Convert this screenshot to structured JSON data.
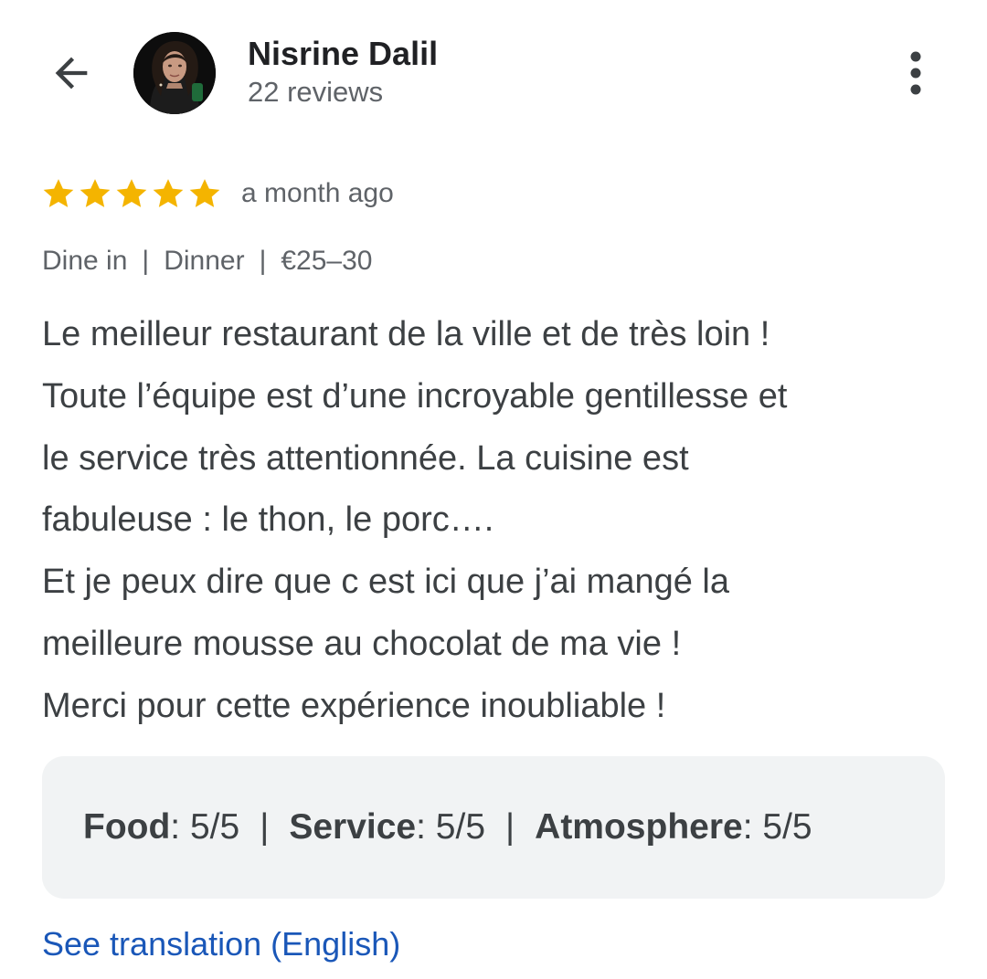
{
  "header": {
    "back_icon": "arrow-back-icon",
    "user_name": "Nisrine Dalil",
    "review_count": "22 reviews",
    "avatar": "profile-photo",
    "more_icon": "more-vert-icon"
  },
  "review": {
    "stars": 5,
    "max_stars": 5,
    "star_color": "#F4B400",
    "time_ago": "a month ago",
    "meta": {
      "service_type": "Dine in",
      "meal_type": "Dinner",
      "price": "€25–30",
      "separator": "|"
    },
    "text": "Le meilleur restaurant de la ville et de très loin !\nToute l’équipe est d’une incroyable gentillesse et\nle service très attentionnée. La cuisine est\nfabuleuse : le thon, le porc….\nEt je peux dire que c est ici que j’ai mangé la\nmeilleure mousse au chocolat de ma vie !\nMerci pour cette expérience inoubliable !"
  },
  "ratings": {
    "food_label": "Food",
    "food_value": ": 5/5",
    "service_label": "Service",
    "service_value": ": 5/5",
    "atmosphere_label": "Atmosphere",
    "atmosphere_value": ": 5/5",
    "separator": "|"
  },
  "footer": {
    "translate_link": "See translation (English)",
    "link_color": "#1a57b8"
  }
}
